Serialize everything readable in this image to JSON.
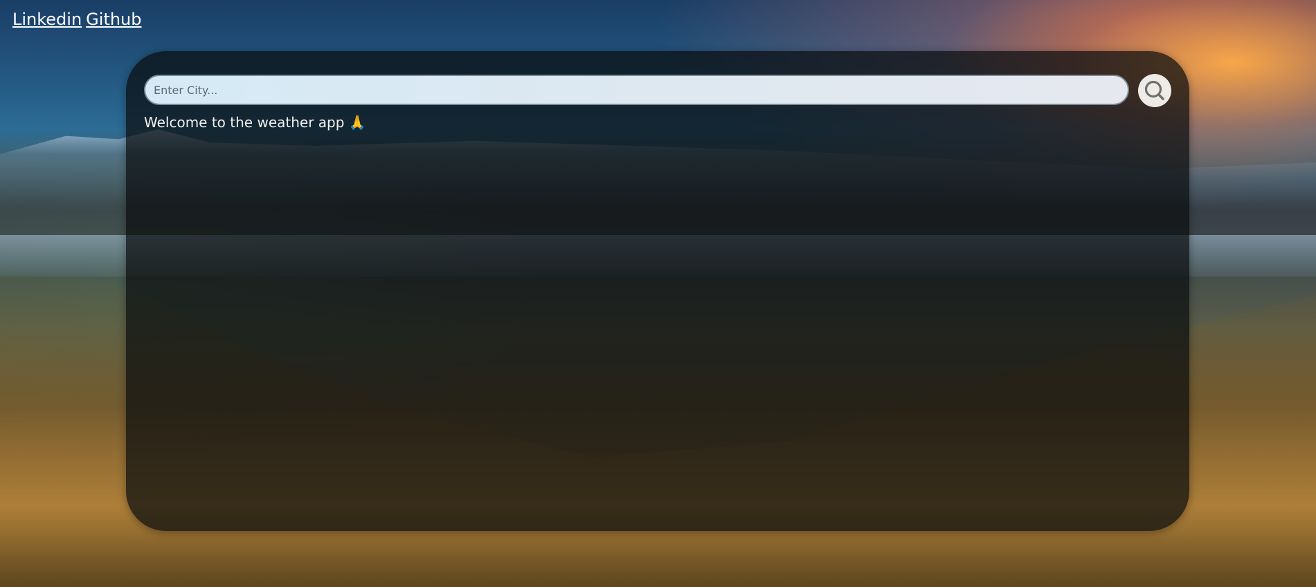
{
  "nav": {
    "links": [
      {
        "label": "Linkedin"
      },
      {
        "label": "Github"
      }
    ]
  },
  "search": {
    "placeholder": "Enter City...",
    "value": "",
    "button_icon": "search-icon"
  },
  "welcome": {
    "text": "Welcome to the weather app 🙏"
  },
  "colors": {
    "card_bg": "rgba(10,12,14,0.72)",
    "link": "#ffffff",
    "text": "#f2f2f2"
  }
}
